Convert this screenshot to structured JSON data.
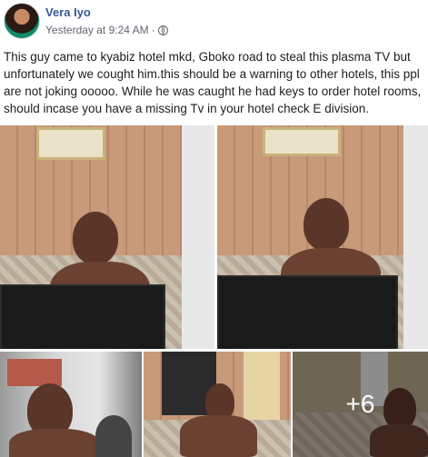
{
  "post": {
    "author": "Vera Iyo",
    "timestamp": "Yesterday at 9:24 AM",
    "separator": "·",
    "text": "This guy came to kyabiz hotel mkd, Gboko road to steal this plasma TV but unfortunately we cought him.this should be a warning to other hotels, this ppl are not joking ooooo. While he was caught he had keys to order hotel rooms, should incase you have a missing Tv in your hotel check E division.",
    "audience_icon": "globe-icon"
  },
  "photos": {
    "more_count": "+6"
  }
}
